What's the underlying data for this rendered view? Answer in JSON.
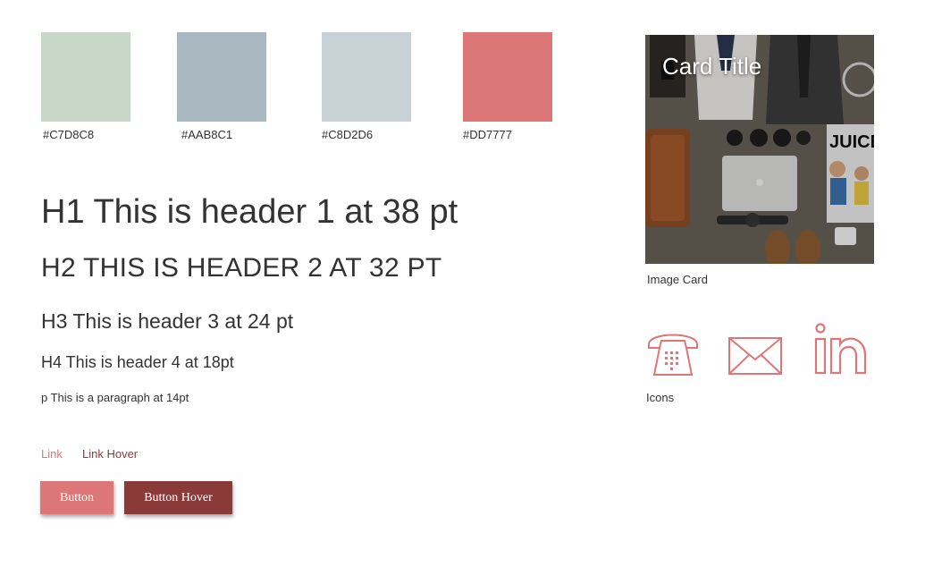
{
  "swatches": [
    {
      "color": "#C7D8C8",
      "label": "#C7D8C8"
    },
    {
      "color": "#AAB8C1",
      "label": "#AAB8C1"
    },
    {
      "color": "#C8D2D6",
      "label": "#C8D2D6"
    },
    {
      "color": "#DD7777",
      "label": "#DD7777"
    }
  ],
  "typography": {
    "h1": "H1 This is header 1 at 38 pt",
    "h2": "H2 This is header 2 at 32 pt",
    "h3": "H3 This is header 3 at 24 pt",
    "h4": "H4 This is header 4 at 18pt",
    "p": "p This is a paragraph at 14pt"
  },
  "links": {
    "link": "Link",
    "link_hover": "Link Hover",
    "link_color": "#DD7777",
    "link_hover_color": "#8B3A3A"
  },
  "buttons": {
    "button": "Button",
    "button_hover": "Button Hover",
    "button_color": "#DD7777",
    "button_hover_color": "#8B3A3A"
  },
  "card": {
    "title": "Card Title",
    "caption": "Image Card"
  },
  "icons": {
    "caption": "Icons",
    "items": [
      "phone-icon",
      "mail-icon",
      "linkedin-icon"
    ],
    "color": "#DD7777"
  }
}
